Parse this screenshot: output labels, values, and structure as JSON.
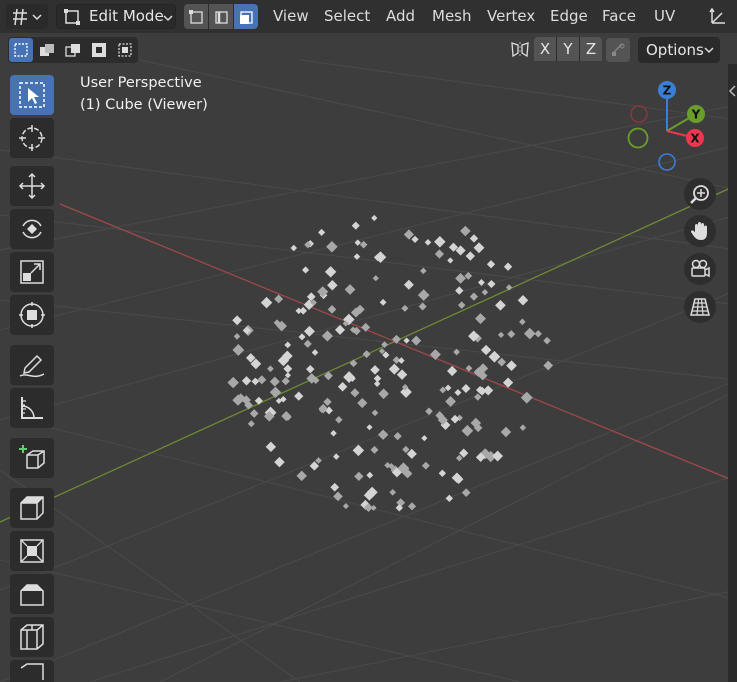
{
  "header": {
    "mode_label": "Edit Mode",
    "menus": [
      "View",
      "Select",
      "Add",
      "Mesh",
      "Vertex",
      "Edge",
      "Face",
      "UV"
    ]
  },
  "subheader": {
    "axes": [
      "X",
      "Y",
      "Z"
    ],
    "options_label": "Options"
  },
  "viewport": {
    "perspective_label": "User Perspective",
    "object_label": "(1) Cube (Viewer)"
  },
  "gizmo": {
    "z": "Z",
    "y": "Y",
    "x": "X",
    "colors": {
      "x": "#f0364f",
      "y": "#6a9e2a",
      "z": "#3a7fd6",
      "neg_x": "#8a3540",
      "neg_y": "#5a7a3a",
      "neg_z": "#3a5a8a"
    }
  },
  "toolbar_tools": [
    "select-box",
    "cursor",
    "move",
    "rotate",
    "scale",
    "transform",
    "annotate",
    "measure",
    "add-cube",
    "extrude",
    "inset",
    "bevel",
    "loop-cut"
  ],
  "nav_tools": [
    "zoom",
    "pan",
    "camera",
    "perspective-grid"
  ],
  "colors": {
    "accent": "#4772b3",
    "header_bg": "#303030",
    "viewport_bg": "#3d3d3d",
    "x_axis": "#a04848",
    "y_axis": "#6c8a34"
  }
}
